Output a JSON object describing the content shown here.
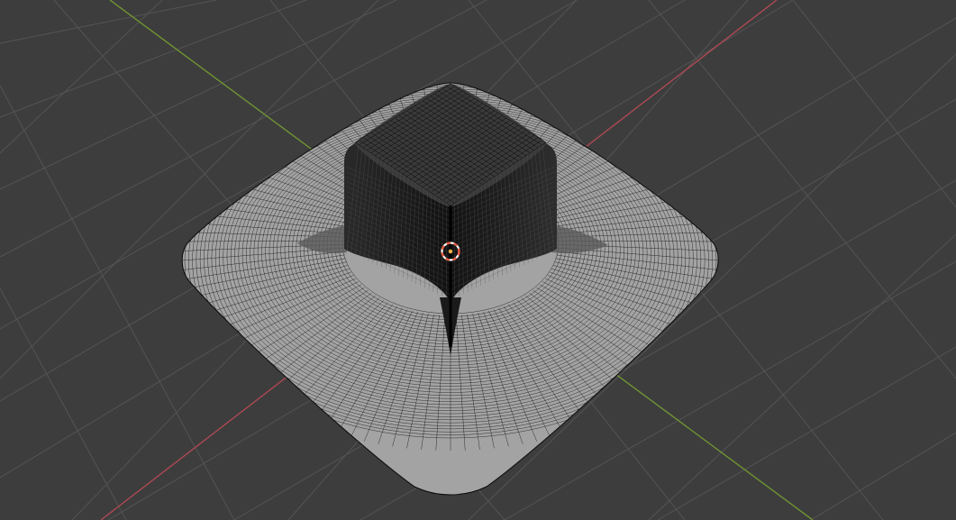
{
  "viewport": {
    "view": "3d-viewport-perspective",
    "mode": "object",
    "shading": "solid-wireframe-overlay",
    "show_grid_floor": true,
    "show_axis_x": true,
    "show_axis_y": true
  },
  "colors": {
    "background": "#3d3d3d",
    "grid_line": "#545454",
    "axis_x": "#ad4853",
    "axis_y": "#6f9433",
    "mesh_face": "#a3a3a3",
    "mesh_wire": "#0a0a0a",
    "mesh_shadow": "#6e6e6e",
    "origin_ring_outer": "#e87545",
    "origin_ring_inner": "#ffffff",
    "origin_dot": "#ffb347"
  },
  "scene": {
    "object": {
      "icon": "mesh-icon",
      "type": "subdivided-plane-with-extruded-box",
      "selected": false
    },
    "cursor": {
      "icon": "3d-cursor-icon"
    }
  }
}
